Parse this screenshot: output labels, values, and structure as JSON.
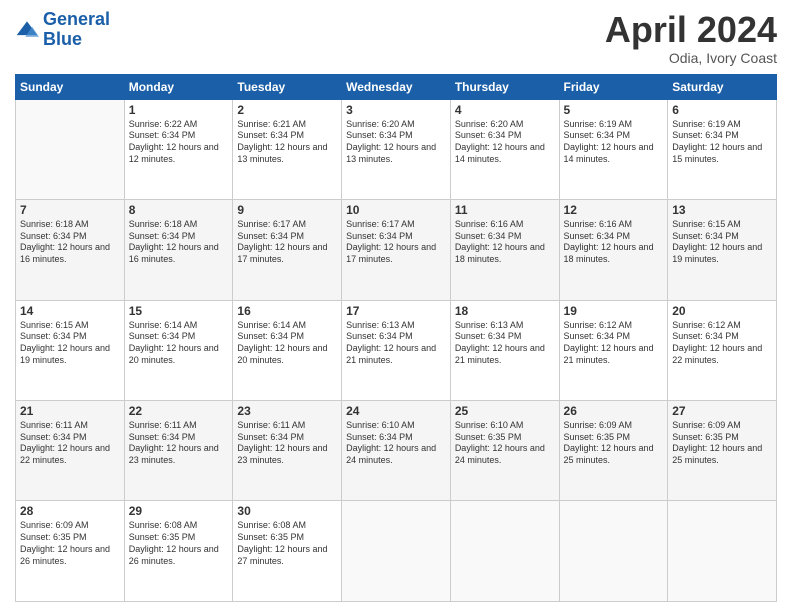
{
  "header": {
    "logo_general": "General",
    "logo_blue": "Blue",
    "month": "April 2024",
    "location": "Odia, Ivory Coast"
  },
  "days_of_week": [
    "Sunday",
    "Monday",
    "Tuesday",
    "Wednesday",
    "Thursday",
    "Friday",
    "Saturday"
  ],
  "weeks": [
    [
      {
        "day": "",
        "sunrise": "",
        "sunset": "",
        "daylight": ""
      },
      {
        "day": "1",
        "sunrise": "Sunrise: 6:22 AM",
        "sunset": "Sunset: 6:34 PM",
        "daylight": "Daylight: 12 hours and 12 minutes."
      },
      {
        "day": "2",
        "sunrise": "Sunrise: 6:21 AM",
        "sunset": "Sunset: 6:34 PM",
        "daylight": "Daylight: 12 hours and 13 minutes."
      },
      {
        "day": "3",
        "sunrise": "Sunrise: 6:20 AM",
        "sunset": "Sunset: 6:34 PM",
        "daylight": "Daylight: 12 hours and 13 minutes."
      },
      {
        "day": "4",
        "sunrise": "Sunrise: 6:20 AM",
        "sunset": "Sunset: 6:34 PM",
        "daylight": "Daylight: 12 hours and 14 minutes."
      },
      {
        "day": "5",
        "sunrise": "Sunrise: 6:19 AM",
        "sunset": "Sunset: 6:34 PM",
        "daylight": "Daylight: 12 hours and 14 minutes."
      },
      {
        "day": "6",
        "sunrise": "Sunrise: 6:19 AM",
        "sunset": "Sunset: 6:34 PM",
        "daylight": "Daylight: 12 hours and 15 minutes."
      }
    ],
    [
      {
        "day": "7",
        "sunrise": "Sunrise: 6:18 AM",
        "sunset": "Sunset: 6:34 PM",
        "daylight": "Daylight: 12 hours and 16 minutes."
      },
      {
        "day": "8",
        "sunrise": "Sunrise: 6:18 AM",
        "sunset": "Sunset: 6:34 PM",
        "daylight": "Daylight: 12 hours and 16 minutes."
      },
      {
        "day": "9",
        "sunrise": "Sunrise: 6:17 AM",
        "sunset": "Sunset: 6:34 PM",
        "daylight": "Daylight: 12 hours and 17 minutes."
      },
      {
        "day": "10",
        "sunrise": "Sunrise: 6:17 AM",
        "sunset": "Sunset: 6:34 PM",
        "daylight": "Daylight: 12 hours and 17 minutes."
      },
      {
        "day": "11",
        "sunrise": "Sunrise: 6:16 AM",
        "sunset": "Sunset: 6:34 PM",
        "daylight": "Daylight: 12 hours and 18 minutes."
      },
      {
        "day": "12",
        "sunrise": "Sunrise: 6:16 AM",
        "sunset": "Sunset: 6:34 PM",
        "daylight": "Daylight: 12 hours and 18 minutes."
      },
      {
        "day": "13",
        "sunrise": "Sunrise: 6:15 AM",
        "sunset": "Sunset: 6:34 PM",
        "daylight": "Daylight: 12 hours and 19 minutes."
      }
    ],
    [
      {
        "day": "14",
        "sunrise": "Sunrise: 6:15 AM",
        "sunset": "Sunset: 6:34 PM",
        "daylight": "Daylight: 12 hours and 19 minutes."
      },
      {
        "day": "15",
        "sunrise": "Sunrise: 6:14 AM",
        "sunset": "Sunset: 6:34 PM",
        "daylight": "Daylight: 12 hours and 20 minutes."
      },
      {
        "day": "16",
        "sunrise": "Sunrise: 6:14 AM",
        "sunset": "Sunset: 6:34 PM",
        "daylight": "Daylight: 12 hours and 20 minutes."
      },
      {
        "day": "17",
        "sunrise": "Sunrise: 6:13 AM",
        "sunset": "Sunset: 6:34 PM",
        "daylight": "Daylight: 12 hours and 21 minutes."
      },
      {
        "day": "18",
        "sunrise": "Sunrise: 6:13 AM",
        "sunset": "Sunset: 6:34 PM",
        "daylight": "Daylight: 12 hours and 21 minutes."
      },
      {
        "day": "19",
        "sunrise": "Sunrise: 6:12 AM",
        "sunset": "Sunset: 6:34 PM",
        "daylight": "Daylight: 12 hours and 21 minutes."
      },
      {
        "day": "20",
        "sunrise": "Sunrise: 6:12 AM",
        "sunset": "Sunset: 6:34 PM",
        "daylight": "Daylight: 12 hours and 22 minutes."
      }
    ],
    [
      {
        "day": "21",
        "sunrise": "Sunrise: 6:11 AM",
        "sunset": "Sunset: 6:34 PM",
        "daylight": "Daylight: 12 hours and 22 minutes."
      },
      {
        "day": "22",
        "sunrise": "Sunrise: 6:11 AM",
        "sunset": "Sunset: 6:34 PM",
        "daylight": "Daylight: 12 hours and 23 minutes."
      },
      {
        "day": "23",
        "sunrise": "Sunrise: 6:11 AM",
        "sunset": "Sunset: 6:34 PM",
        "daylight": "Daylight: 12 hours and 23 minutes."
      },
      {
        "day": "24",
        "sunrise": "Sunrise: 6:10 AM",
        "sunset": "Sunset: 6:34 PM",
        "daylight": "Daylight: 12 hours and 24 minutes."
      },
      {
        "day": "25",
        "sunrise": "Sunrise: 6:10 AM",
        "sunset": "Sunset: 6:35 PM",
        "daylight": "Daylight: 12 hours and 24 minutes."
      },
      {
        "day": "26",
        "sunrise": "Sunrise: 6:09 AM",
        "sunset": "Sunset: 6:35 PM",
        "daylight": "Daylight: 12 hours and 25 minutes."
      },
      {
        "day": "27",
        "sunrise": "Sunrise: 6:09 AM",
        "sunset": "Sunset: 6:35 PM",
        "daylight": "Daylight: 12 hours and 25 minutes."
      }
    ],
    [
      {
        "day": "28",
        "sunrise": "Sunrise: 6:09 AM",
        "sunset": "Sunset: 6:35 PM",
        "daylight": "Daylight: 12 hours and 26 minutes."
      },
      {
        "day": "29",
        "sunrise": "Sunrise: 6:08 AM",
        "sunset": "Sunset: 6:35 PM",
        "daylight": "Daylight: 12 hours and 26 minutes."
      },
      {
        "day": "30",
        "sunrise": "Sunrise: 6:08 AM",
        "sunset": "Sunset: 6:35 PM",
        "daylight": "Daylight: 12 hours and 27 minutes."
      },
      {
        "day": "",
        "sunrise": "",
        "sunset": "",
        "daylight": ""
      },
      {
        "day": "",
        "sunrise": "",
        "sunset": "",
        "daylight": ""
      },
      {
        "day": "",
        "sunrise": "",
        "sunset": "",
        "daylight": ""
      },
      {
        "day": "",
        "sunrise": "",
        "sunset": "",
        "daylight": ""
      }
    ]
  ]
}
